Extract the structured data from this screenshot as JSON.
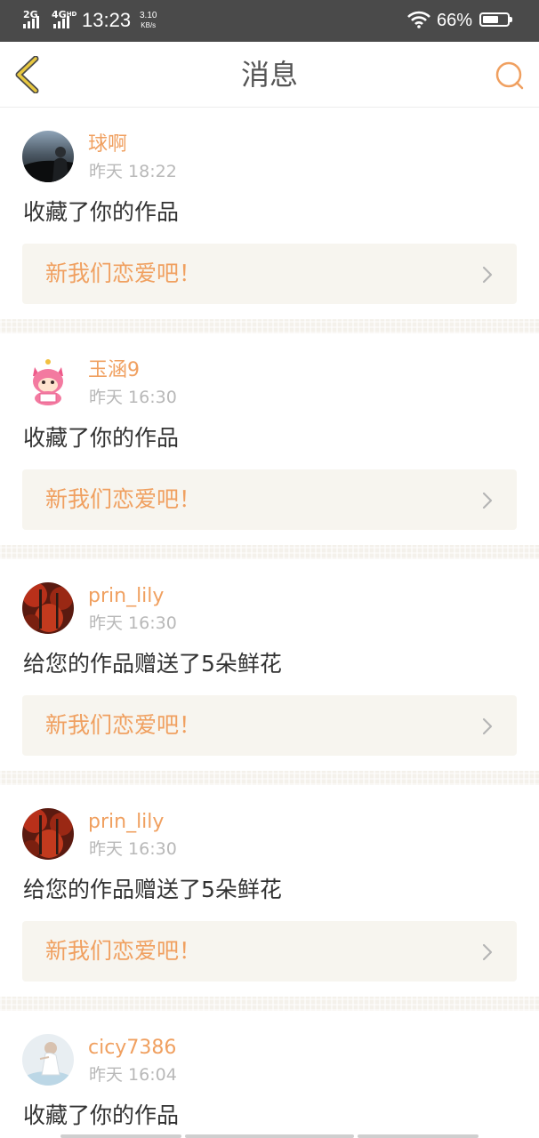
{
  "status_bar": {
    "network_1": "2G",
    "network_2": "4G",
    "network_2_suffix": "HD",
    "time": "13:23",
    "speed_value": "3.10",
    "speed_unit": "KB/s",
    "battery_percent": "66%",
    "battery_level": 0.66
  },
  "header": {
    "title": "消息",
    "back_icon": "chevron-left-icon",
    "search_icon": "search-icon"
  },
  "colors": {
    "accent": "#f0a060",
    "back_icon": "#c8a020",
    "text": "#333333",
    "muted": "#b8b8b8"
  },
  "messages": [
    {
      "username": "球啊",
      "time": "昨天 18:22",
      "action": "收藏了你的作品",
      "work_title": "新我们恋爱吧！"
    },
    {
      "username": "玉涵9",
      "time": "昨天 16:30",
      "action": "收藏了你的作品",
      "work_title": "新我们恋爱吧！"
    },
    {
      "username": "prin_lily",
      "time": "昨天 16:30",
      "action": "给您的作品赠送了5朵鲜花",
      "work_title": "新我们恋爱吧！"
    },
    {
      "username": "prin_lily",
      "time": "昨天 16:30",
      "action": "给您的作品赠送了5朵鲜花",
      "work_title": "新我们恋爱吧！"
    },
    {
      "username": "cicy7386",
      "time": "昨天 16:04",
      "action": "收藏了你的作品"
    }
  ]
}
